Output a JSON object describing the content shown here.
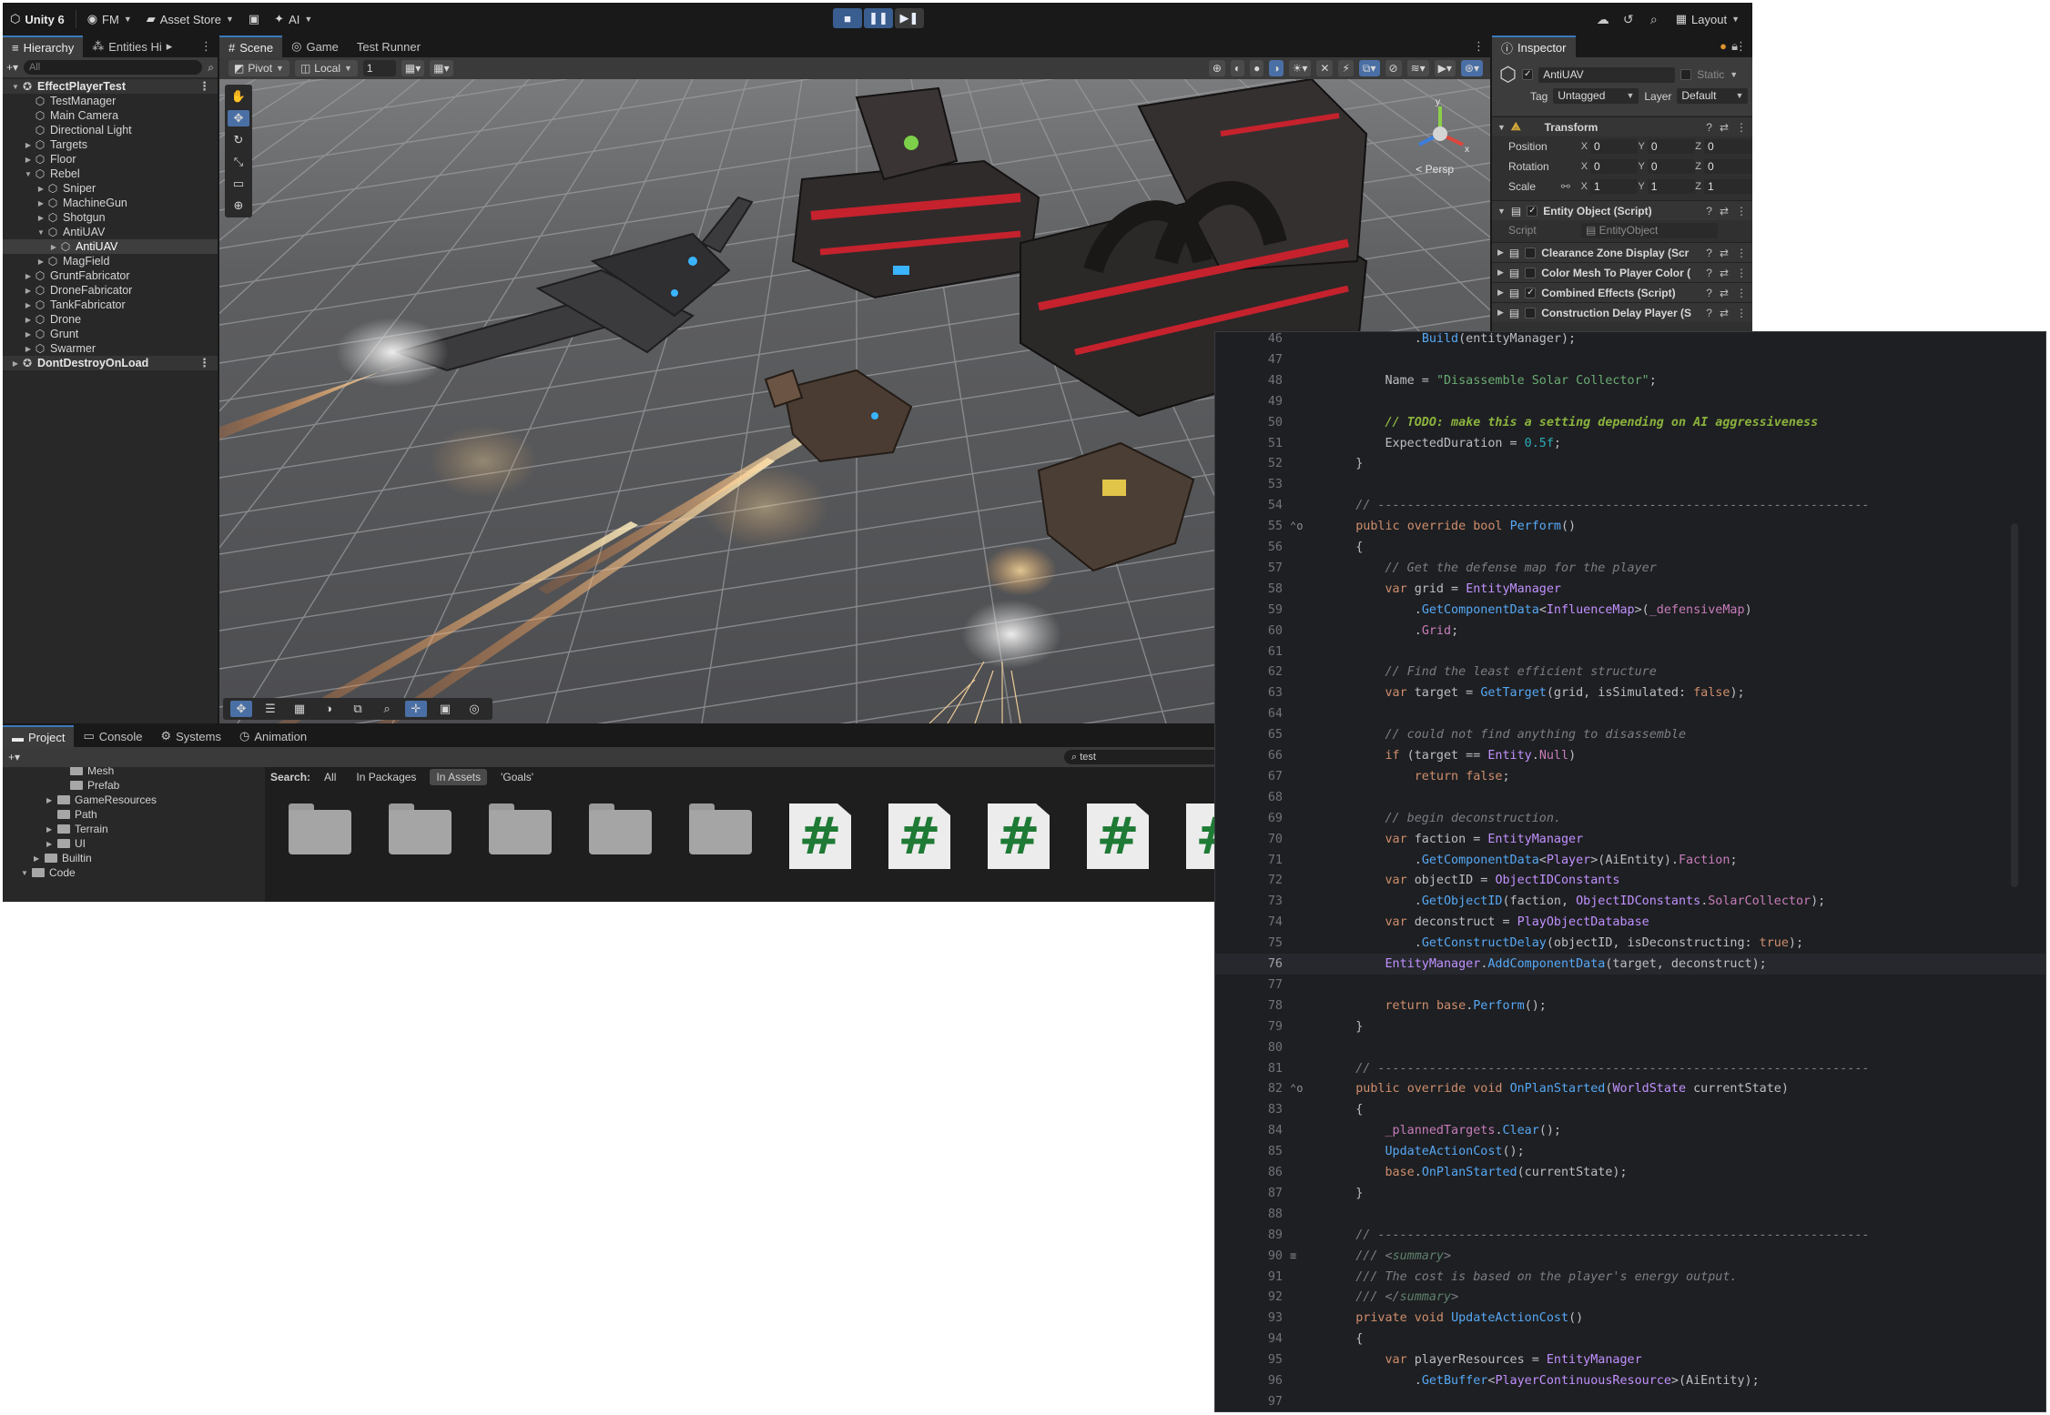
{
  "toolbar": {
    "app": "Unity 6",
    "account": "FM",
    "asset_store": "Asset Store",
    "ai": "AI",
    "layout": "Layout"
  },
  "hierarchy": {
    "tab_label": "Hierarchy",
    "tab2_label": "Entities Hi",
    "search_placeholder": "All",
    "rows": [
      {
        "label": "EffectPlayerTest",
        "depth": 0,
        "kind": "scene",
        "arrow": "▼"
      },
      {
        "label": "TestManager",
        "depth": 1,
        "kind": "obj",
        "arrow": ""
      },
      {
        "label": "Main Camera",
        "depth": 1,
        "kind": "obj",
        "arrow": ""
      },
      {
        "label": "Directional Light",
        "depth": 1,
        "kind": "obj",
        "arrow": ""
      },
      {
        "label": "Targets",
        "depth": 1,
        "kind": "obj",
        "arrow": "▶"
      },
      {
        "label": "Floor",
        "depth": 1,
        "kind": "obj",
        "arrow": "▶"
      },
      {
        "label": "Rebel",
        "depth": 1,
        "kind": "obj",
        "arrow": "▼"
      },
      {
        "label": "Sniper",
        "depth": 2,
        "kind": "obj",
        "arrow": "▶"
      },
      {
        "label": "MachineGun",
        "depth": 2,
        "kind": "obj",
        "arrow": "▶"
      },
      {
        "label": "Shotgun",
        "depth": 2,
        "kind": "obj",
        "arrow": "▶"
      },
      {
        "label": "AntiUAV",
        "depth": 2,
        "kind": "obj",
        "arrow": "▼"
      },
      {
        "label": "AntiUAV",
        "depth": 3,
        "kind": "sel",
        "arrow": "▶"
      },
      {
        "label": "MagField",
        "depth": 2,
        "kind": "obj",
        "arrow": "▶"
      },
      {
        "label": "GruntFabricator",
        "depth": 1,
        "kind": "obj",
        "arrow": "▶"
      },
      {
        "label": "DroneFabricator",
        "depth": 1,
        "kind": "obj",
        "arrow": "▶"
      },
      {
        "label": "TankFabricator",
        "depth": 1,
        "kind": "obj",
        "arrow": "▶"
      },
      {
        "label": "Drone",
        "depth": 1,
        "kind": "obj",
        "arrow": "▶"
      },
      {
        "label": "Grunt",
        "depth": 1,
        "kind": "obj",
        "arrow": "▶"
      },
      {
        "label": "Swarmer",
        "depth": 1,
        "kind": "obj",
        "arrow": "▶"
      },
      {
        "label": "DontDestroyOnLoad",
        "depth": 0,
        "kind": "scene",
        "arrow": "▶"
      }
    ]
  },
  "scene": {
    "tabs": [
      "Scene",
      "Game",
      "Test Runner"
    ],
    "pivot": "Pivot",
    "space": "Local",
    "grid_value": "1",
    "persp": "< Persp"
  },
  "inspector": {
    "tab_label": "Inspector",
    "object_name": "AntiUAV",
    "static_label": "Static",
    "tag_label": "Tag",
    "tag_value": "Untagged",
    "layer_label": "Layer",
    "layer_value": "Default",
    "transform_title": "Transform",
    "transform_rows": [
      {
        "label": "Position",
        "x": "0",
        "y": "0",
        "z": "0"
      },
      {
        "label": "Rotation",
        "x": "0",
        "y": "0",
        "z": "0"
      },
      {
        "label": "Scale",
        "x": "1",
        "y": "1",
        "z": "1"
      }
    ],
    "entity_component": "Entity Object (Script)",
    "script_label": "Script",
    "script_value": "EntityObject",
    "components": [
      {
        "label": "Clearance Zone Display (Scr",
        "checked": false
      },
      {
        "label": "Color Mesh To Player Color (",
        "checked": false
      },
      {
        "label": "Combined Effects (Script)",
        "checked": true
      },
      {
        "label": "Construction Delay Player (S",
        "checked": false
      }
    ]
  },
  "project": {
    "tabs": [
      "Project",
      "Console",
      "Systems",
      "Animation"
    ],
    "search_value": "test",
    "search_label": "Search:",
    "filters": [
      "All",
      "In Packages",
      "In Assets",
      "'Goals'"
    ],
    "tree": [
      {
        "label": "Mesh",
        "depth": 4
      },
      {
        "label": "Prefab",
        "depth": 4
      },
      {
        "label": "GameResources",
        "depth": 3
      },
      {
        "label": "Path",
        "depth": 3
      },
      {
        "label": "Terrain",
        "depth": 3
      },
      {
        "label": "UI",
        "depth": 3
      },
      {
        "label": "Builtin",
        "depth": 2
      },
      {
        "label": "Code",
        "depth": 1
      }
    ],
    "script_glyph": "#"
  },
  "ide": {
    "lines": [
      {
        "n": 46,
        "t": "            .Build(entityManager);"
      },
      {
        "n": 47,
        "t": ""
      },
      {
        "n": 48,
        "t": "        Name = \"Disassemble Solar Collector\";"
      },
      {
        "n": 49,
        "t": ""
      },
      {
        "n": 50,
        "t": "        // TODO: make this a setting depending on AI aggressiveness"
      },
      {
        "n": 51,
        "t": "        ExpectedDuration = 0.5f;"
      },
      {
        "n": 52,
        "t": "    }"
      },
      {
        "n": 53,
        "t": ""
      },
      {
        "n": 54,
        "t": "    // -------------------------------------------------------------------"
      },
      {
        "n": 55,
        "t": "    public override bool Perform()"
      },
      {
        "n": 56,
        "t": "    {"
      },
      {
        "n": 57,
        "t": "        // Get the defense map for the player"
      },
      {
        "n": 58,
        "t": "        var grid = EntityManager"
      },
      {
        "n": 59,
        "t": "            .GetComponentData<InfluenceMap>(_defensiveMap)"
      },
      {
        "n": 60,
        "t": "            .Grid;"
      },
      {
        "n": 61,
        "t": ""
      },
      {
        "n": 62,
        "t": "        // Find the least efficient structure"
      },
      {
        "n": 63,
        "t": "        var target = GetTarget(grid, isSimulated: false);"
      },
      {
        "n": 64,
        "t": ""
      },
      {
        "n": 65,
        "t": "        // could not find anything to disassemble"
      },
      {
        "n": 66,
        "t": "        if (target == Entity.Null)"
      },
      {
        "n": 67,
        "t": "            return false;"
      },
      {
        "n": 68,
        "t": ""
      },
      {
        "n": 69,
        "t": "        // begin deconstruction."
      },
      {
        "n": 70,
        "t": "        var faction = EntityManager"
      },
      {
        "n": 71,
        "t": "            .GetComponentData<Player>(AiEntity).Faction;"
      },
      {
        "n": 72,
        "t": "        var objectID = ObjectIDConstants"
      },
      {
        "n": 73,
        "t": "            .GetObjectID(faction, ObjectIDConstants.SolarCollector);"
      },
      {
        "n": 74,
        "t": "        var deconstruct = PlayObjectDatabase"
      },
      {
        "n": 75,
        "t": "            .GetConstructDelay(objectID, isDeconstructing: true);"
      },
      {
        "n": 76,
        "t": "        EntityManager.AddComponentData(target, deconstruct);"
      },
      {
        "n": 77,
        "t": ""
      },
      {
        "n": 78,
        "t": "        return base.Perform();"
      },
      {
        "n": 79,
        "t": "    }"
      },
      {
        "n": 80,
        "t": ""
      },
      {
        "n": 81,
        "t": "    // -------------------------------------------------------------------"
      },
      {
        "n": 82,
        "t": "    public override void OnPlanStarted(WorldState currentState)"
      },
      {
        "n": 83,
        "t": "    {"
      },
      {
        "n": 84,
        "t": "        _plannedTargets.Clear();"
      },
      {
        "n": 85,
        "t": "        UpdateActionCost();"
      },
      {
        "n": 86,
        "t": "        base.OnPlanStarted(currentState);"
      },
      {
        "n": 87,
        "t": "    }"
      },
      {
        "n": 88,
        "t": ""
      },
      {
        "n": 89,
        "t": "    // -------------------------------------------------------------------"
      },
      {
        "n": 90,
        "t": "    /// <summary>"
      },
      {
        "n": 91,
        "t": "    /// The cost is based on the player's energy output."
      },
      {
        "n": 92,
        "t": "    /// </summary>"
      },
      {
        "n": 93,
        "t": "    private void UpdateActionCost()"
      },
      {
        "n": 94,
        "t": "    {"
      },
      {
        "n": 95,
        "t": "        var playerResources = EntityManager"
      },
      {
        "n": 96,
        "t": "            .GetBuffer<PlayerContinuousResource>(AiEntity);"
      },
      {
        "n": 97,
        "t": ""
      }
    ]
  }
}
